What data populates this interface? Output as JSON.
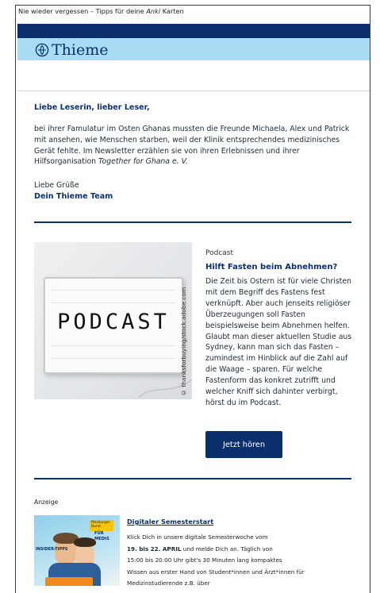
{
  "preheader": {
    "text_before": "Nie wieder vergessen – Tipps für deine ",
    "text_em": "Anki",
    "text_after": " Karten"
  },
  "brand": {
    "logo_text": "Thieme",
    "dark_blue": "#0b2f6c",
    "light_blue": "#a8dcf5"
  },
  "intro": {
    "greeting": "Liebe Leserin, lieber Leser,",
    "body_before": "bei ihrer Famulatur im Osten Ghanas mussten die Freunde Michaela, Alex und Patrick mit ansehen, wie Menschen starben, weil der Klinik entsprechendes medizinisches Gerät fehlte. Im Newsletter erzählen sie von ihren Erlebnissen und ihrer Hilfsorganisation ",
    "body_em": "Together for Ghana e. V.",
    "regards": "Liebe Grüße",
    "team": "Dein Thieme Team"
  },
  "podcast": {
    "image_word": "PODCAST",
    "image_credit": "© thanksforbuying/stock.adobe.com",
    "category": "Podcast",
    "title": "Hilft Fasten beim Abnehmen?",
    "body": "Die Zeit bis Ostern ist für viele Christen mit dem Begriff des Fastens fest verknüpft. Aber auch jenseits religiöser Überzeugungen soll Fasten beispielsweise beim Abnehmen helfen. Glaubt man dieser aktuellen Studie aus Sydney, kann man sich das Fasten – zumindest im Hinblick auf die Zahl auf die Waage – sparen. Für welche Fastenform das konkret zutrifft und welcher Kniff sich dahinter verbirgt, hörst du im Podcast.",
    "button_label": "Jetzt hören"
  },
  "ad": {
    "label": "Anzeige",
    "image_badge": "Marburger Bund",
    "image_left_text": "INSIDER-TIPPS",
    "image_right_text": "FÜR MEDIS",
    "title": "Digitaler Semesterstart",
    "line1": "Klick Dich in unsere digitale Semesterwoche vom",
    "line2_bold": "19. bis 22. APRIL",
    "line2_rest": " und melde Dich an. Täglich von",
    "line3": "15:00 bis 20:00 Uhr gibt's 30 Minuten lang kompaktes",
    "line4": "Wissen aus erster Hand von Student*innen und Ärzt*innen für",
    "line5": "Medizinstudierende z.B. über"
  }
}
